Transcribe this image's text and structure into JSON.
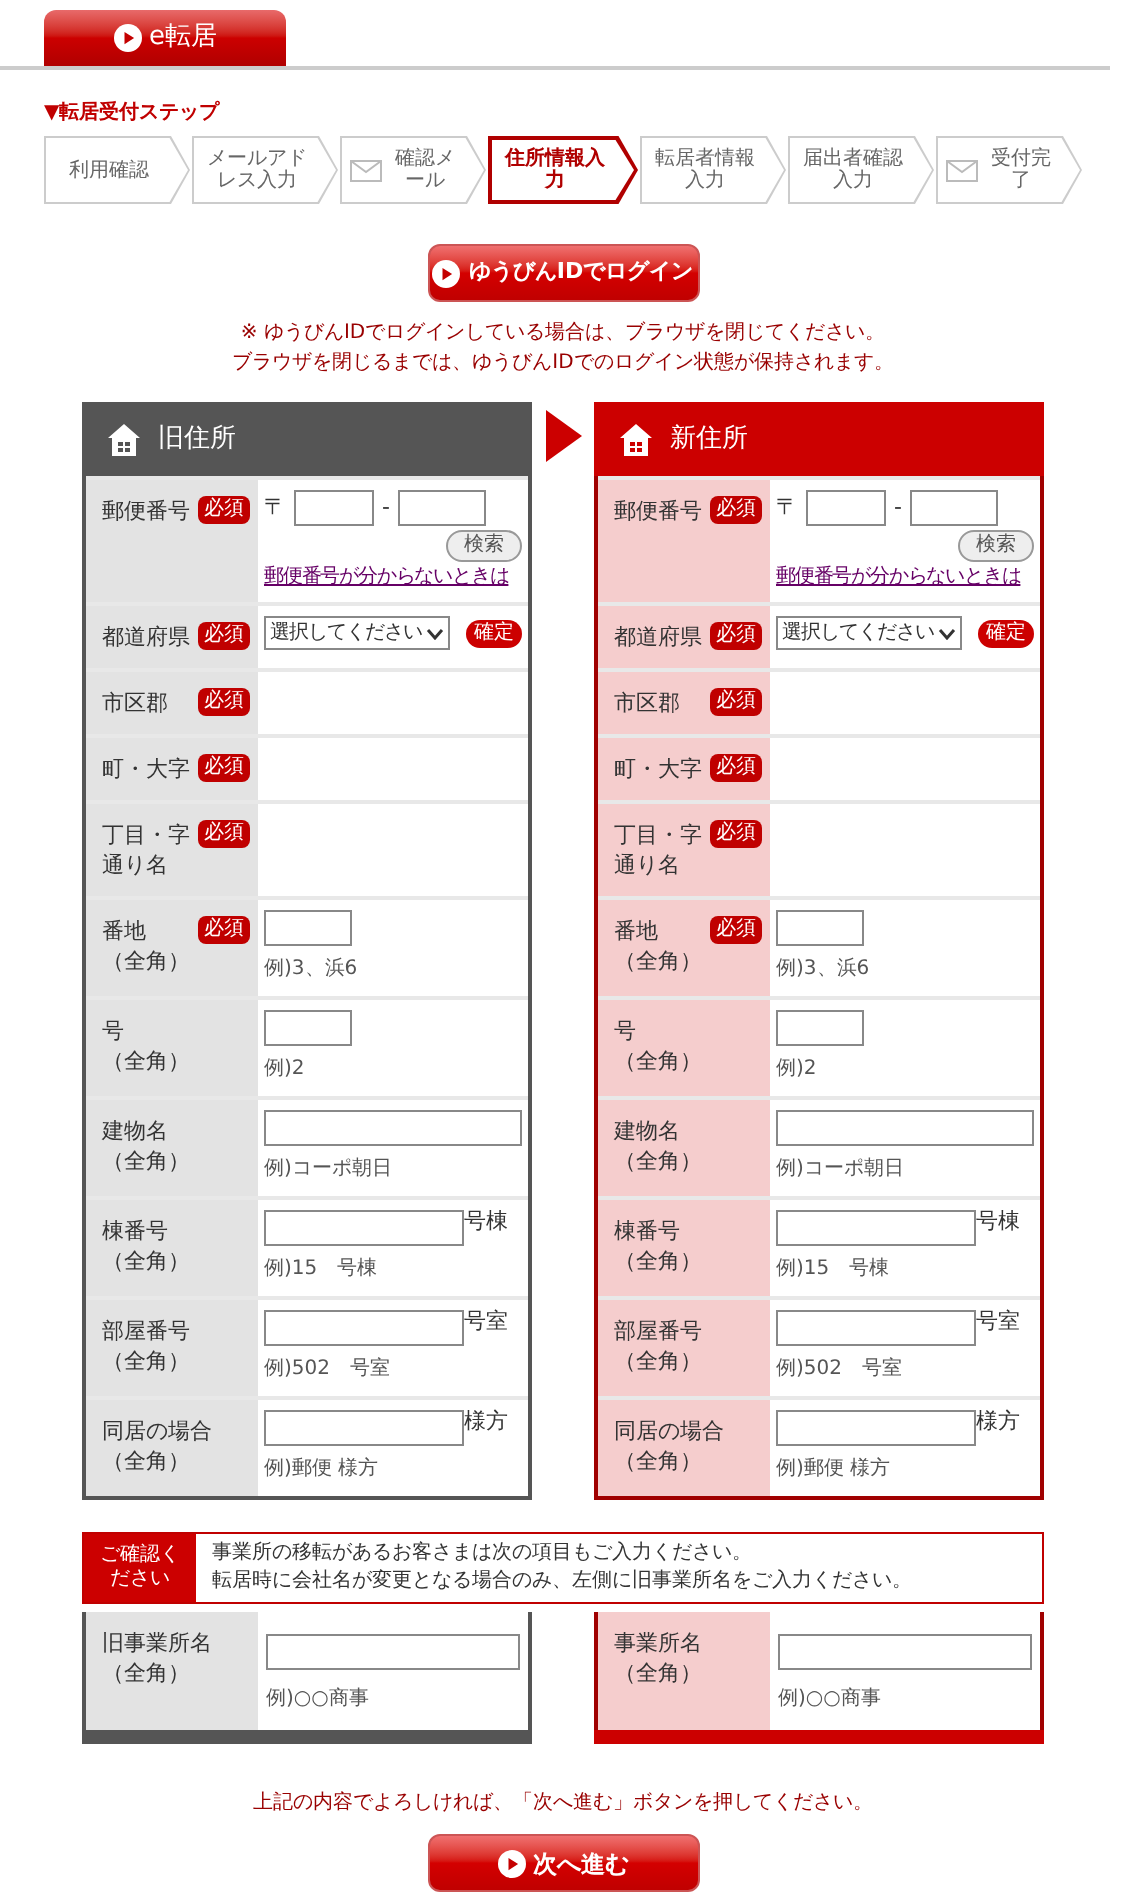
{
  "app_title": "e転居",
  "steps": {
    "title": "▼転居受付ステップ",
    "items": [
      {
        "label": "利用確認",
        "kind": "plain",
        "selected": false
      },
      {
        "label": "メールアドレス入力",
        "kind": "plain",
        "selected": false
      },
      {
        "label": "確認メール",
        "kind": "mail",
        "selected": false
      },
      {
        "label": "住所情報入力",
        "kind": "plain",
        "selected": true
      },
      {
        "label": "転居者情報入力",
        "kind": "plain",
        "selected": false
      },
      {
        "label": "届出者確認入力",
        "kind": "plain",
        "selected": false
      },
      {
        "label": "受付完了",
        "kind": "mail",
        "selected": false
      }
    ]
  },
  "login_button": "ゆうびんIDでログイン",
  "login_notes": [
    "※ ゆうびんIDでログインしている場合は、ブラウザを閉じてください。",
    "ブラウザを閉じるまでは、ゆうびんIDでのログイン状態が保持されます。"
  ],
  "panels": [
    {
      "title": "旧住所",
      "kind": "old",
      "rows": [
        {
          "kind": "postal",
          "label": "郵便番号",
          "badge": "必須",
          "zip_mark": "〒",
          "dash": "-",
          "search": "検索",
          "link": "郵便番号が分からないときは"
        },
        {
          "kind": "prefecture",
          "label": "都道府県",
          "badge": "必須",
          "select": "選択してください",
          "confirm": "確定"
        },
        {
          "kind": "empty",
          "label": "市区郡",
          "badge": "必須"
        },
        {
          "kind": "empty",
          "label": "町・大字",
          "badge": "必須"
        },
        {
          "kind": "empty",
          "label": "丁目・字",
          "sublabel": "通り名",
          "badge": "必須"
        },
        {
          "kind": "short_input",
          "label": "番地",
          "sublabel": "（全角）",
          "badge": "必須",
          "example": "例)3、浜6"
        },
        {
          "kind": "short_input",
          "label": "号",
          "sublabel": "（全角）",
          "example": "例)2"
        },
        {
          "kind": "long_input",
          "label": "建物名",
          "sublabel": "（全角）",
          "example": "例)コーポ朝日"
        },
        {
          "kind": "unit_input",
          "label": "棟番号",
          "sublabel": "（全角）",
          "suffix": "号棟",
          "example": "例)15　号棟"
        },
        {
          "kind": "unit_input",
          "label": "部屋番号",
          "sublabel": "（全角）",
          "suffix": "号室",
          "example": "例)502　号室"
        },
        {
          "kind": "unit_input",
          "label": "同居の場合",
          "sublabel": "（全角）",
          "suffix": "様方",
          "example": "例)郵便 様方"
        }
      ],
      "business_row": {
        "label": "旧事業所名",
        "sublabel": "（全角）",
        "example": "例)○○商事"
      }
    },
    {
      "title": "新住所",
      "kind": "new",
      "rows": [
        {
          "kind": "postal",
          "label": "郵便番号",
          "badge": "必須",
          "zip_mark": "〒",
          "dash": "-",
          "search": "検索",
          "link": "郵便番号が分からないときは"
        },
        {
          "kind": "prefecture",
          "label": "都道府県",
          "badge": "必須",
          "select": "選択してください",
          "confirm": "確定"
        },
        {
          "kind": "empty",
          "label": "市区郡",
          "badge": "必須"
        },
        {
          "kind": "empty",
          "label": "町・大字",
          "badge": "必須"
        },
        {
          "kind": "empty",
          "label": "丁目・字",
          "sublabel": "通り名",
          "badge": "必須"
        },
        {
          "kind": "short_input",
          "label": "番地",
          "sublabel": "（全角）",
          "badge": "必須",
          "example": "例)3、浜6"
        },
        {
          "kind": "short_input",
          "label": "号",
          "sublabel": "（全角）",
          "example": "例)2"
        },
        {
          "kind": "long_input",
          "label": "建物名",
          "sublabel": "（全角）",
          "example": "例)コーポ朝日"
        },
        {
          "kind": "unit_input",
          "label": "棟番号",
          "sublabel": "（全角）",
          "suffix": "号棟",
          "example": "例)15　号棟"
        },
        {
          "kind": "unit_input",
          "label": "部屋番号",
          "sublabel": "（全角）",
          "suffix": "号室",
          "example": "例)502　号室"
        },
        {
          "kind": "unit_input",
          "label": "同居の場合",
          "sublabel": "（全角）",
          "suffix": "様方",
          "example": "例)郵便 様方"
        }
      ],
      "business_row": {
        "label": "事業所名",
        "sublabel": "（全角）",
        "example": "例)○○商事"
      }
    }
  ],
  "notice": {
    "tag": "ご確認ください",
    "lines": [
      "事業所の移転があるお客さまは次の項目もご入力ください。",
      "転居時に会社名が変更となる場合のみ、左側に旧事業所名をご入力ください。"
    ]
  },
  "footer_note": "上記の内容でよろしければ、「次へ進む」ボタンを押してください。",
  "next_button": "次へ進む"
}
